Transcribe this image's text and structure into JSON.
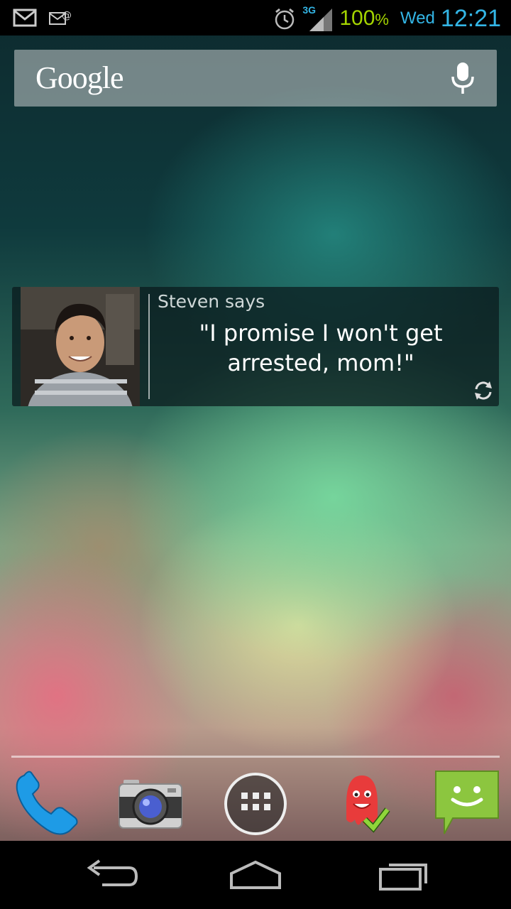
{
  "status_bar": {
    "battery": "100",
    "battery_unit": "%",
    "network": "3G",
    "day": "Wed",
    "time": "12:21",
    "icons": [
      "gmail-icon",
      "email-icon",
      "alarm-icon",
      "signal-icon"
    ]
  },
  "search": {
    "logo": "Google",
    "icon": "mic-icon"
  },
  "widget": {
    "author": "Steven says",
    "quote": "\"I promise I won't get arrested, mom!\"",
    "icon": "refresh-icon"
  },
  "dock": {
    "items": [
      "phone-icon",
      "camera-icon",
      "app-drawer-icon",
      "octopus-app-icon",
      "messaging-icon"
    ]
  },
  "nav": {
    "buttons": [
      "back-icon",
      "home-icon",
      "recents-icon"
    ]
  },
  "colors": {
    "accent_blue": "#33b5e5",
    "battery_green": "#a4d400"
  }
}
